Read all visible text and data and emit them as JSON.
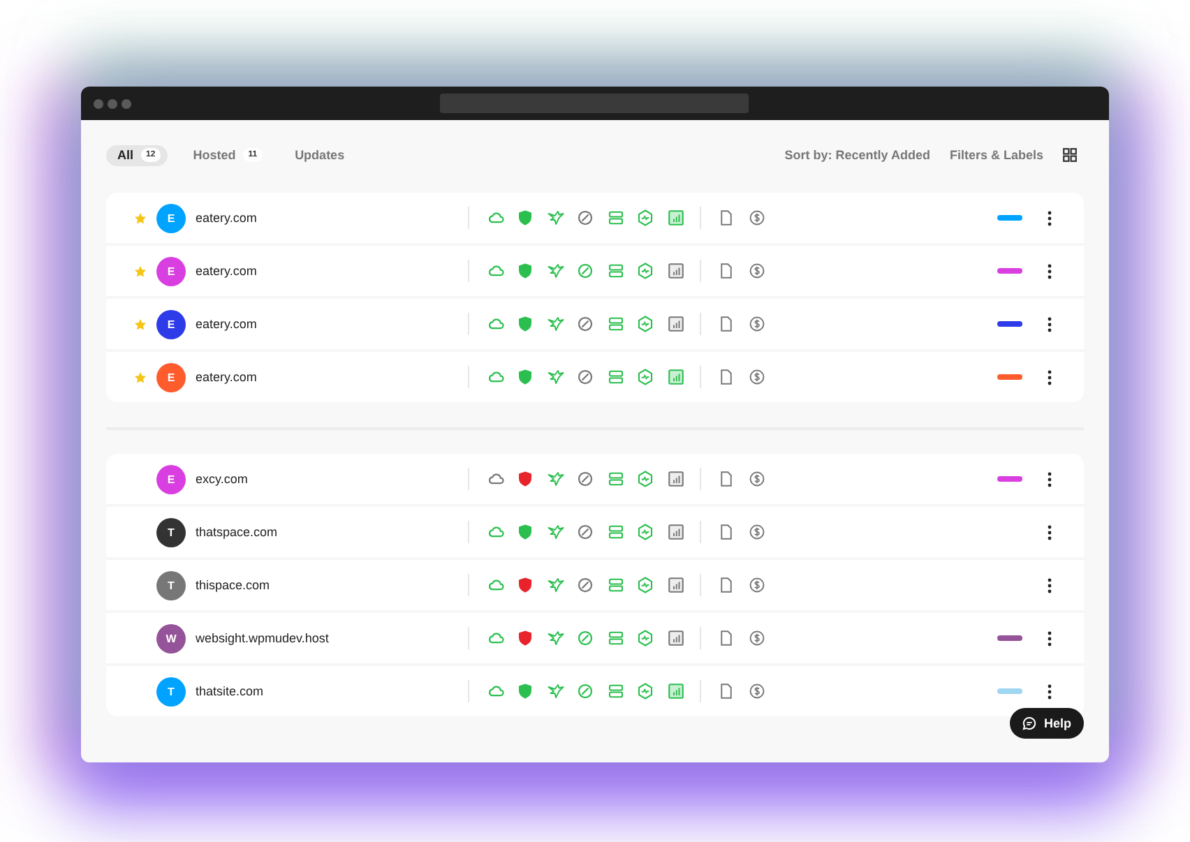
{
  "tabs": [
    {
      "label": "All",
      "count": "12",
      "selected": true
    },
    {
      "label": "Hosted",
      "count": "11",
      "selected": false
    },
    {
      "label": "Updates",
      "selected": false
    }
  ],
  "toolbar": {
    "sort": "Sort by: Recently Added",
    "filters": "Filters & Labels"
  },
  "groups": [
    {
      "sites": [
        {
          "name": "eatery.com",
          "initial": "E",
          "color": "#00a3ff",
          "starred": true,
          "label": {
            "color": "#00a3ff"
          },
          "services": [
            {
              "kind": "cloud",
              "active": true,
              "alert": false
            },
            {
              "kind": "shield",
              "active": true,
              "alert": false
            },
            {
              "kind": "bird",
              "active": true,
              "alert": false
            },
            {
              "kind": "circle",
              "active": false,
              "alert": false
            },
            {
              "kind": "server",
              "active": true,
              "alert": false
            },
            {
              "kind": "hexagon",
              "active": true,
              "alert": false
            },
            {
              "kind": "chart",
              "active": true,
              "alert": false
            }
          ]
        },
        {
          "name": "eatery.com",
          "initial": "E",
          "color": "#d93fe0",
          "starred": true,
          "label": {
            "color": "#d93fe0"
          },
          "services": [
            {
              "kind": "cloud",
              "active": true,
              "alert": false
            },
            {
              "kind": "shield",
              "active": true,
              "alert": false
            },
            {
              "kind": "bird",
              "active": true,
              "alert": false
            },
            {
              "kind": "circle",
              "active": true,
              "alert": false
            },
            {
              "kind": "server",
              "active": true,
              "alert": false
            },
            {
              "kind": "hexagon",
              "active": true,
              "alert": false
            },
            {
              "kind": "chart",
              "active": false,
              "alert": false
            }
          ]
        },
        {
          "name": "eatery.com",
          "initial": "E",
          "color": "#2e3be8",
          "starred": true,
          "label": {
            "color": "#2e3be8"
          },
          "services": [
            {
              "kind": "cloud",
              "active": true,
              "alert": false
            },
            {
              "kind": "shield",
              "active": true,
              "alert": false
            },
            {
              "kind": "bird",
              "active": true,
              "alert": false
            },
            {
              "kind": "circle",
              "active": false,
              "alert": false
            },
            {
              "kind": "server",
              "active": true,
              "alert": false
            },
            {
              "kind": "hexagon",
              "active": true,
              "alert": false
            },
            {
              "kind": "chart",
              "active": false,
              "alert": false
            }
          ]
        },
        {
          "name": "eatery.com",
          "initial": "E",
          "color": "#ff5c2e",
          "starred": true,
          "label": {
            "color": "#ff5c2e"
          },
          "services": [
            {
              "kind": "cloud",
              "active": true,
              "alert": false
            },
            {
              "kind": "shield",
              "active": true,
              "alert": false
            },
            {
              "kind": "bird",
              "active": true,
              "alert": false
            },
            {
              "kind": "circle",
              "active": false,
              "alert": false
            },
            {
              "kind": "server",
              "active": true,
              "alert": false
            },
            {
              "kind": "hexagon",
              "active": true,
              "alert": false
            },
            {
              "kind": "chart",
              "active": true,
              "alert": false
            }
          ]
        }
      ]
    },
    {
      "sites": [
        {
          "name": "excy.com",
          "initial": "E",
          "color": "#d93fe0",
          "starred": false,
          "label": {
            "color": "#d93fe0"
          },
          "services": [
            {
              "kind": "cloud",
              "active": false,
              "alert": false
            },
            {
              "kind": "shield",
              "active": true,
              "alert": true
            },
            {
              "kind": "bird",
              "active": true,
              "alert": false
            },
            {
              "kind": "circle",
              "active": false,
              "alert": false
            },
            {
              "kind": "server",
              "active": true,
              "alert": false
            },
            {
              "kind": "hexagon",
              "active": true,
              "alert": false
            },
            {
              "kind": "chart",
              "active": false,
              "alert": false
            }
          ]
        },
        {
          "name": "thatspace.com",
          "initial": "T",
          "color": "#333333",
          "starred": false,
          "services": [
            {
              "kind": "cloud",
              "active": true,
              "alert": false
            },
            {
              "kind": "shield",
              "active": true,
              "alert": false
            },
            {
              "kind": "bird",
              "active": true,
              "alert": false
            },
            {
              "kind": "circle",
              "active": false,
              "alert": false
            },
            {
              "kind": "server",
              "active": true,
              "alert": false
            },
            {
              "kind": "hexagon",
              "active": true,
              "alert": false
            },
            {
              "kind": "chart",
              "active": false,
              "alert": false
            }
          ]
        },
        {
          "name": "thispace.com",
          "initial": "T",
          "color": "#777777",
          "starred": false,
          "services": [
            {
              "kind": "cloud",
              "active": true,
              "alert": false
            },
            {
              "kind": "shield",
              "active": true,
              "alert": true
            },
            {
              "kind": "bird",
              "active": true,
              "alert": false
            },
            {
              "kind": "circle",
              "active": false,
              "alert": false
            },
            {
              "kind": "server",
              "active": true,
              "alert": false
            },
            {
              "kind": "hexagon",
              "active": true,
              "alert": false
            },
            {
              "kind": "chart",
              "active": false,
              "alert": false
            }
          ]
        },
        {
          "name": "websight.wpmudev.host",
          "initial": "W",
          "color": "#955399",
          "starred": false,
          "label": {
            "color": "#955399"
          },
          "services": [
            {
              "kind": "cloud",
              "active": true,
              "alert": false
            },
            {
              "kind": "shield",
              "active": true,
              "alert": true
            },
            {
              "kind": "bird",
              "active": true,
              "alert": false
            },
            {
              "kind": "circle",
              "active": true,
              "alert": false
            },
            {
              "kind": "server",
              "active": true,
              "alert": false
            },
            {
              "kind": "hexagon",
              "active": true,
              "alert": false
            },
            {
              "kind": "chart",
              "active": false,
              "alert": false
            }
          ]
        },
        {
          "name": "thatsite.com",
          "initial": "T",
          "color": "#00a3ff",
          "starred": false,
          "label": {
            "color": "#9fd6f2"
          },
          "services": [
            {
              "kind": "cloud",
              "active": true,
              "alert": false
            },
            {
              "kind": "shield",
              "active": true,
              "alert": false
            },
            {
              "kind": "bird",
              "active": true,
              "alert": false
            },
            {
              "kind": "circle",
              "active": true,
              "alert": false
            },
            {
              "kind": "server",
              "active": true,
              "alert": false
            },
            {
              "kind": "hexagon",
              "active": true,
              "alert": false
            },
            {
              "kind": "chart",
              "active": true,
              "alert": false
            }
          ]
        }
      ]
    }
  ],
  "help": {
    "label": "Help"
  }
}
